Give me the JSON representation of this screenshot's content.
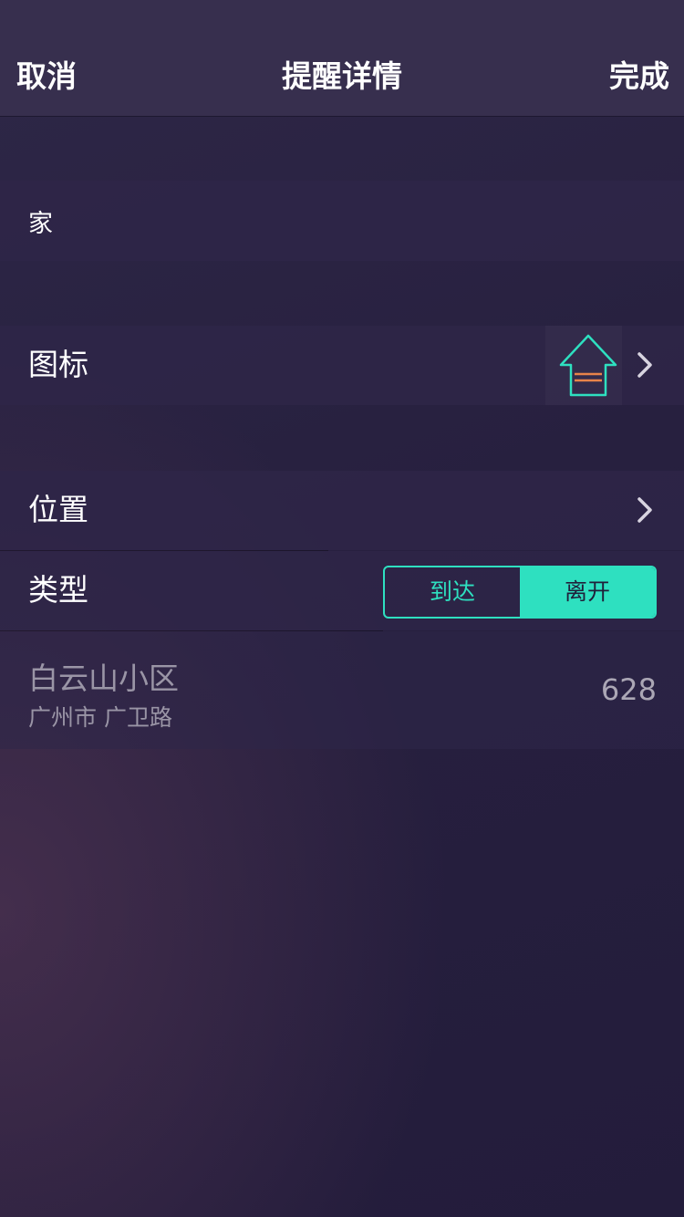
{
  "navbar": {
    "cancel_label": "取消",
    "title": "提醒详情",
    "done_label": "完成"
  },
  "name_field": {
    "value": "家"
  },
  "icon_row": {
    "label": "图标",
    "icon": "house-icon",
    "accent_color": "#2ee0c0",
    "line_color": "#e8834a"
  },
  "location_row": {
    "label": "位置"
  },
  "type_row": {
    "label": "类型",
    "options": [
      "到达",
      "离开"
    ],
    "selected": "离开"
  },
  "address": {
    "title": "白云山小区",
    "subtitle": "广州市 广卫路",
    "number": "628"
  }
}
